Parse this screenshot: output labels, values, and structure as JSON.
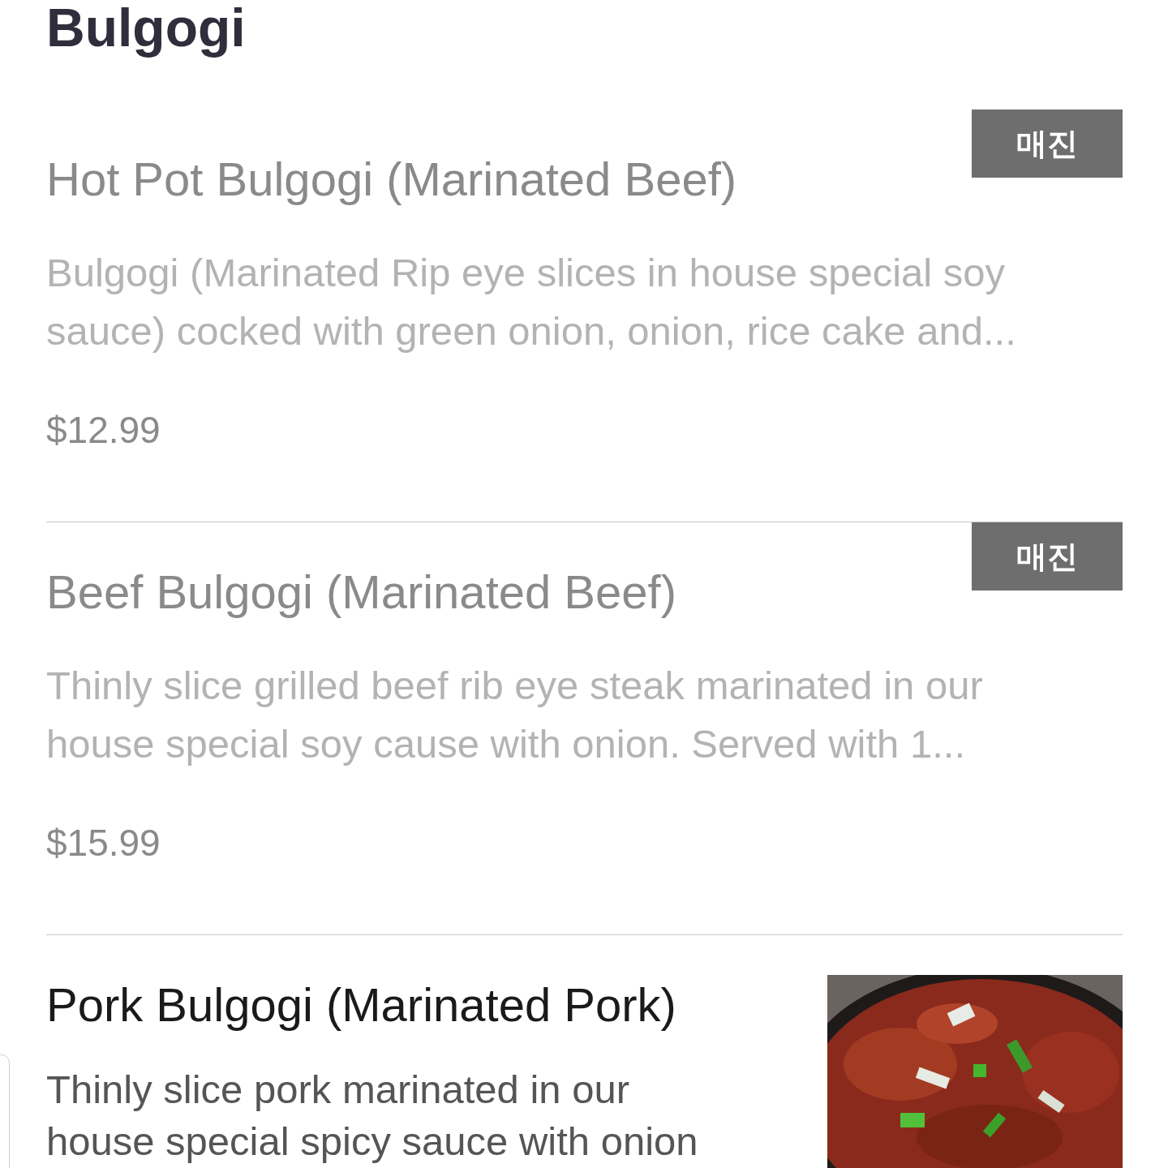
{
  "section": {
    "title": "Bulgogi"
  },
  "items": [
    {
      "name": "Hot Pot Bulgogi (Marinated Beef)",
      "description": "Bulgogi (Marinated Rip eye slices in house special soy sauce) cocked with green onion, onion, rice cake and...",
      "price": "$12.99",
      "sold_out": true,
      "badge": "매진"
    },
    {
      "name": "Beef Bulgogi (Marinated Beef)",
      "description": "Thinly slice grilled beef rib eye steak marinated in our house special soy cause with onion. Served with 1...",
      "price": "$15.99",
      "sold_out": true,
      "badge": "매진"
    },
    {
      "name": "Pork Bulgogi (Marinated Pork)",
      "description": "Thinly slice pork marinated in our house special spicy sauce with onion",
      "sold_out": false
    }
  ]
}
